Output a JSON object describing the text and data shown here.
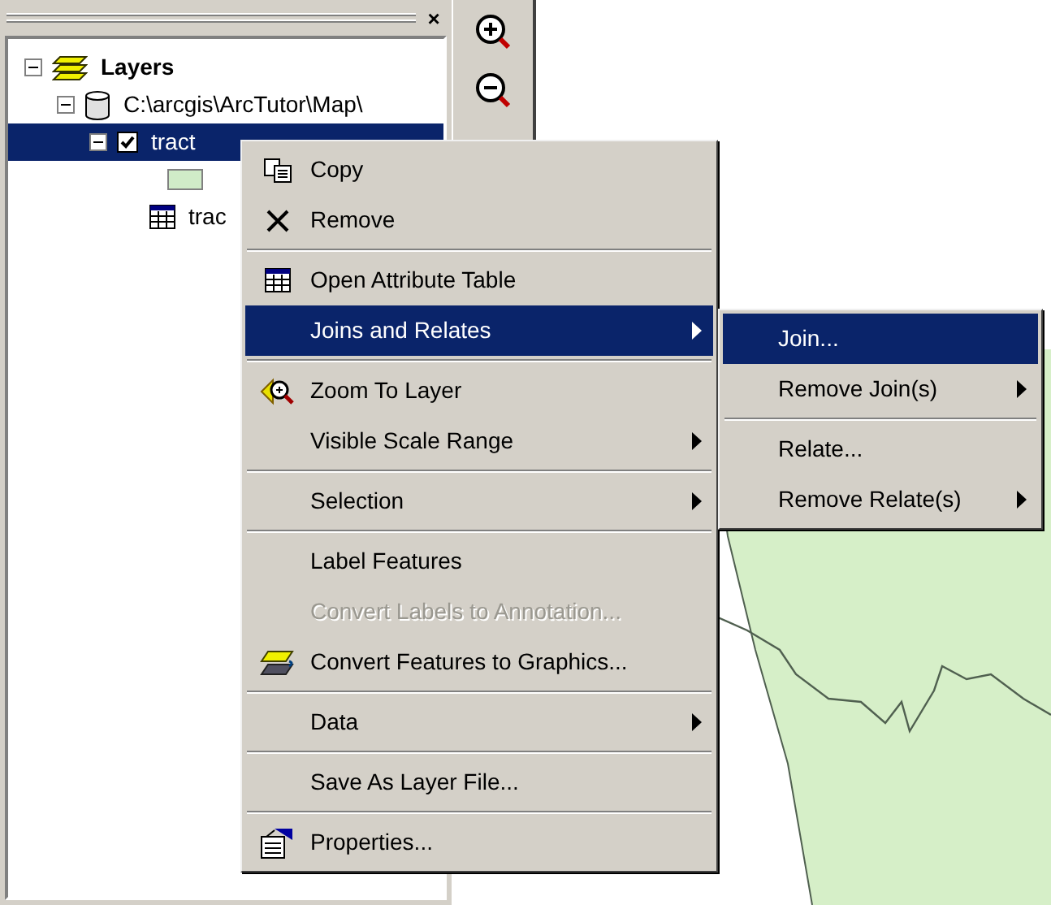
{
  "toc": {
    "close": "×",
    "tree": [
      {
        "kind": "group",
        "label": "Layers",
        "expanded": true,
        "selected": false,
        "children": [
          {
            "kind": "workspace",
            "label": "C:\\arcgis\\ArcTutor\\Map\\",
            "expanded": true,
            "selected": false,
            "children": [
              {
                "kind": "layer",
                "label": "tract",
                "expanded": true,
                "checked": true,
                "selected": true
              },
              {
                "kind": "table",
                "label": "trac",
                "selected": false
              }
            ]
          }
        ]
      }
    ]
  },
  "context_menu": {
    "items": [
      {
        "kind": "item",
        "label": "Copy",
        "disabled": false,
        "selected": false,
        "submenu": false
      },
      {
        "kind": "item",
        "label": "Remove",
        "disabled": false,
        "selected": false,
        "submenu": false
      },
      {
        "kind": "separator"
      },
      {
        "kind": "item",
        "label": "Open Attribute Table",
        "disabled": false,
        "selected": false,
        "submenu": false
      },
      {
        "kind": "item",
        "label": "Joins and Relates",
        "disabled": false,
        "selected": true,
        "submenu": true
      },
      {
        "kind": "separator"
      },
      {
        "kind": "item",
        "label": "Zoom To Layer",
        "disabled": false,
        "selected": false,
        "submenu": false
      },
      {
        "kind": "item",
        "label": "Visible Scale Range",
        "disabled": false,
        "selected": false,
        "submenu": true
      },
      {
        "kind": "separator"
      },
      {
        "kind": "item",
        "label": "Selection",
        "disabled": false,
        "selected": false,
        "submenu": true
      },
      {
        "kind": "separator"
      },
      {
        "kind": "item",
        "label": "Label Features",
        "disabled": false,
        "selected": false,
        "submenu": false
      },
      {
        "kind": "item",
        "label": "Convert Labels to Annotation...",
        "disabled": true,
        "selected": false,
        "submenu": false
      },
      {
        "kind": "item",
        "label": "Convert Features to Graphics...",
        "disabled": false,
        "selected": false,
        "submenu": false
      },
      {
        "kind": "separator"
      },
      {
        "kind": "item",
        "label": "Data",
        "disabled": false,
        "selected": false,
        "submenu": true
      },
      {
        "kind": "separator"
      },
      {
        "kind": "item",
        "label": "Save As Layer File...",
        "disabled": false,
        "selected": false,
        "submenu": false
      },
      {
        "kind": "separator"
      },
      {
        "kind": "item",
        "label": "Properties...",
        "disabled": false,
        "selected": false,
        "submenu": false
      }
    ]
  },
  "submenu": {
    "items": [
      {
        "kind": "item",
        "label": "Join...",
        "disabled": false,
        "selected": true,
        "submenu": false
      },
      {
        "kind": "item",
        "label": "Remove Join(s)",
        "disabled": false,
        "selected": false,
        "submenu": true
      },
      {
        "kind": "separator"
      },
      {
        "kind": "item",
        "label": "Relate...",
        "disabled": false,
        "selected": false,
        "submenu": false
      },
      {
        "kind": "item",
        "label": "Remove Relate(s)",
        "disabled": false,
        "selected": false,
        "submenu": true
      }
    ]
  }
}
